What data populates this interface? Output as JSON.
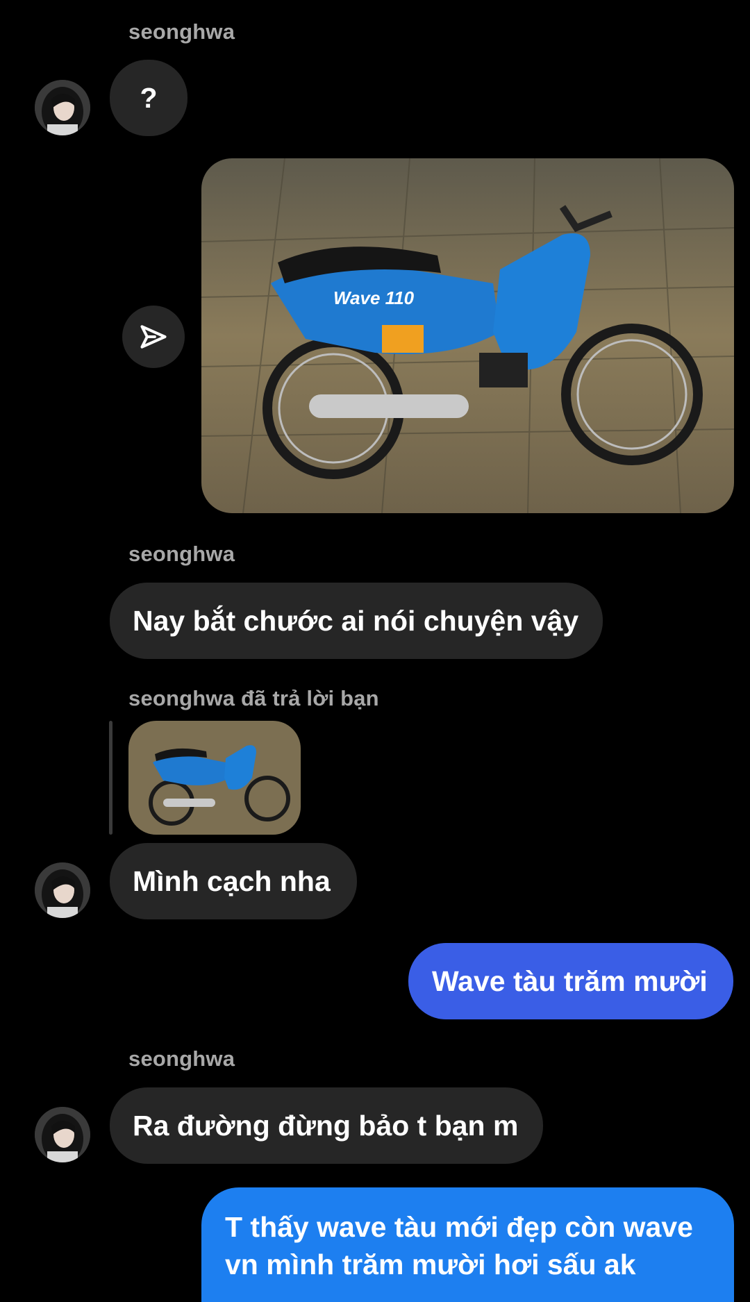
{
  "messages": {
    "m1": {
      "sender": "seonghwa",
      "text": "?"
    },
    "m2": {
      "photo_caption": "Wave 110"
    },
    "m3": {
      "sender": "seonghwa",
      "text": "Nay bắt chước ai nói chuyện vậy"
    },
    "m4": {
      "reply_label": "seonghwa đã trả lời bạn",
      "text": "Mình cạch nha"
    },
    "m5": {
      "text": "Wave tàu trăm mười"
    },
    "m6": {
      "sender": "seonghwa",
      "text": "Ra đường đừng bảo t bạn m"
    },
    "m7": {
      "line1": "T thấy wave tàu mới đẹp còn wave",
      "line2": "vn mình trăm mười hơi sấu ak"
    }
  },
  "colors": {
    "background": "#000000",
    "incoming_bubble": "#262626",
    "outgoing_blue": "#3a5ee6",
    "outgoing_light_blue": "#1d7ff0",
    "sender_name": "#a8a8a8"
  },
  "icons": {
    "share": "paper-plane-icon",
    "avatar": "profile-avatar"
  }
}
